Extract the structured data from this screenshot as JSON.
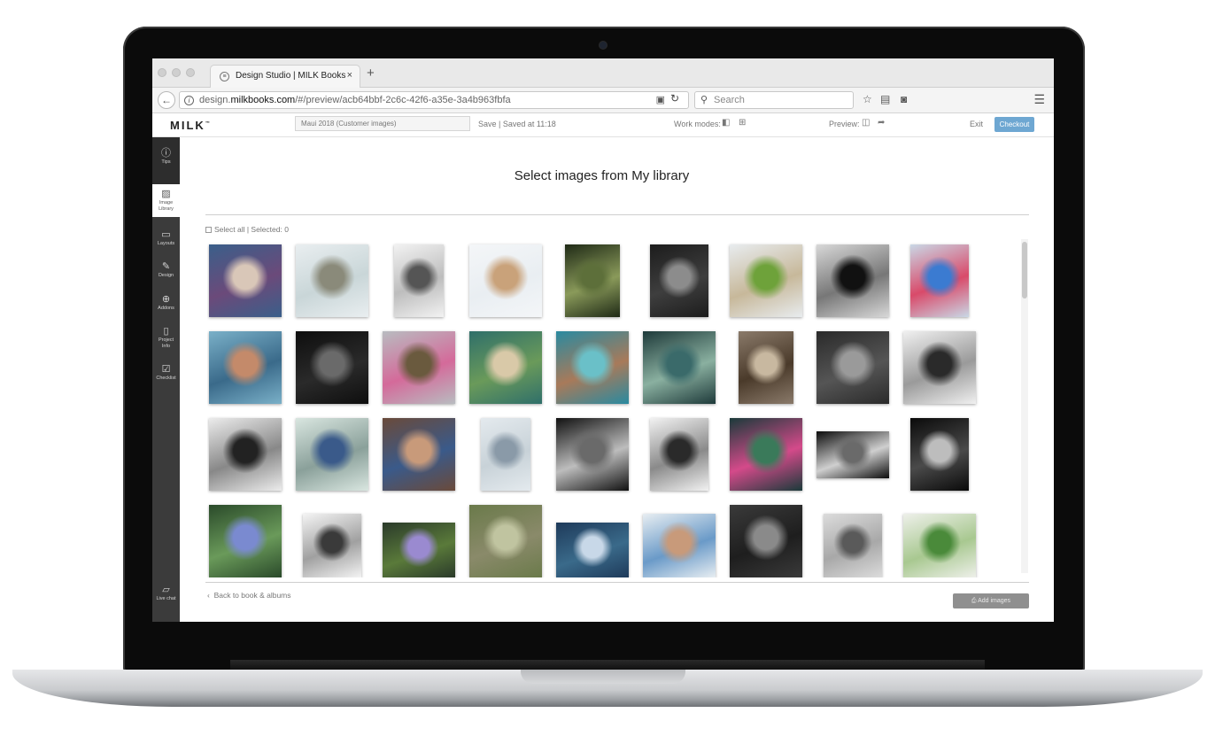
{
  "browser": {
    "tab_title": "Design Studio | MILK Books",
    "tab_close": "×",
    "new_tab": "+",
    "url_prefix": "design.",
    "url_domain": "milkbooks.com",
    "url_path": "/#/preview/acb64bbf-2c6c-42f6-a35e-3a4b963fbfa",
    "search_placeholder": "Search",
    "icons": [
      "back-arrow-icon",
      "info-icon",
      "reader-icon",
      "reload-icon",
      "search-icon",
      "star-icon",
      "clipboard-icon",
      "pocket-icon",
      "menu-icon"
    ]
  },
  "app": {
    "logo": "MILK",
    "logo_mark": "™",
    "project_name": "Maui 2018 (Customer images)",
    "save_status": "Save  |  Saved at 11:18",
    "work_modes_label": "Work modes:",
    "preview_label": "Preview:",
    "exit_label": "Exit",
    "checkout_label": "Checkout"
  },
  "sidebar": {
    "items": [
      {
        "label": "Tips",
        "icon": "info-icon"
      },
      {
        "label": "Image Library",
        "icon": "image-icon"
      },
      {
        "label": "Layouts",
        "icon": "layouts-icon"
      },
      {
        "label": "Design",
        "icon": "pencil-icon"
      },
      {
        "label": "Addons",
        "icon": "addons-icon"
      },
      {
        "label": "Project Info",
        "icon": "document-icon"
      },
      {
        "label": "Checklist",
        "icon": "checklist-icon"
      },
      {
        "label": "Live chat",
        "icon": "chat-icon"
      }
    ]
  },
  "library": {
    "heading": "Select images from My library",
    "select_all": "Select all | Selected: 0",
    "back_link": "Back to book & albums",
    "add_images": "Add images"
  },
  "photos": [
    {
      "subject": "girl-in-blanket",
      "colors": [
        "#3a5f8a",
        "#d9c7b8",
        "#6b4a7a"
      ]
    },
    {
      "subject": "fluffy-dog",
      "colors": [
        "#e9eef0",
        "#8a8a7a",
        "#c9d6d8"
      ]
    },
    {
      "subject": "girl-portrait-bw",
      "colors": [
        "#f2f2f2",
        "#555",
        "#bdbdbd"
      ]
    },
    {
      "subject": "girl-with-hat",
      "colors": [
        "#f4f6f8",
        "#c9a27a",
        "#e9eef2"
      ]
    },
    {
      "subject": "mossy-tree",
      "colors": [
        "#1f2a16",
        "#5d6f3a",
        "#8a9a5a"
      ]
    },
    {
      "subject": "child-at-table-bw",
      "colors": [
        "#1c1c1c",
        "#8c8c8c",
        "#3e3e3e"
      ]
    },
    {
      "subject": "dog-on-lawn",
      "colors": [
        "#e8ecef",
        "#6ea23a",
        "#c7b89a"
      ]
    },
    {
      "subject": "girl-fur-hat-bw",
      "colors": [
        "#d8d8d8",
        "#111",
        "#777"
      ]
    },
    {
      "subject": "girl-in-snow",
      "colors": [
        "#c9d8e6",
        "#3b7bd1",
        "#d94a6a"
      ]
    },
    {
      "subject": "family-hug",
      "colors": [
        "#7ab0c8",
        "#c48a6a",
        "#3a6a8a"
      ]
    },
    {
      "subject": "child-by-window-bw",
      "colors": [
        "#0e0e0e",
        "#6a6a6a",
        "#2a2a2a"
      ]
    },
    {
      "subject": "girl-in-field",
      "colors": [
        "#b8bcc0",
        "#6a5a3e",
        "#d46a9a"
      ]
    },
    {
      "subject": "girls-at-foosball",
      "colors": [
        "#2f6f6a",
        "#d9c9a8",
        "#6a9a5a"
      ]
    },
    {
      "subject": "kid-in-lake",
      "colors": [
        "#2a8aa0",
        "#6ac0c8",
        "#a87a5a"
      ]
    },
    {
      "subject": "girl-in-forest",
      "colors": [
        "#1e3a3a",
        "#3a6a6a",
        "#8ab0a0"
      ]
    },
    {
      "subject": "kid-on-tracks",
      "colors": [
        "#8a7a6a",
        "#c8b8a0",
        "#4a3a2a"
      ]
    },
    {
      "subject": "kids-swimming-bw",
      "colors": [
        "#2a2a2a",
        "#9a9a9a",
        "#555"
      ]
    },
    {
      "subject": "child-blowing-bw",
      "colors": [
        "#f0f0f0",
        "#2a2a2a",
        "#9a9a9a"
      ]
    },
    {
      "subject": "kids-on-pier-bw",
      "colors": [
        "#ececec",
        "#222",
        "#888"
      ]
    },
    {
      "subject": "boy-in-snow",
      "colors": [
        "#d9e6e0",
        "#3a5a8a",
        "#8aa09a"
      ]
    },
    {
      "subject": "girl-holding-hands",
      "colors": [
        "#6a4a3a",
        "#c89a7a",
        "#3a5a8a"
      ]
    },
    {
      "subject": "dock-on-water",
      "colors": [
        "#e4eaee",
        "#8a9aa8",
        "#c8d2d8"
      ]
    },
    {
      "subject": "girl-fur-hat-2-bw",
      "colors": [
        "#111",
        "#6a6a6a",
        "#bdbdbd"
      ]
    },
    {
      "subject": "boy-with-dog-bw",
      "colors": [
        "#f2f2f2",
        "#2a2a2a",
        "#8a8a8a"
      ]
    },
    {
      "subject": "pink-flowers",
      "colors": [
        "#1a3a3a",
        "#3a7a5a",
        "#d44a8a"
      ]
    },
    {
      "subject": "girl-lying-bw",
      "colors": [
        "#0c0c0c",
        "#6a6a6a",
        "#cfcfcf"
      ]
    },
    {
      "subject": "girl-with-dog-bw",
      "colors": [
        "#0a0a0a",
        "#bdbdbd",
        "#4a4a4a"
      ]
    },
    {
      "subject": "thistle-flowers",
      "colors": [
        "#2a4a2a",
        "#7a8ad0",
        "#6a9a5a"
      ]
    },
    {
      "subject": "girl-with-cat-bw",
      "colors": [
        "#f4f4f4",
        "#3a3a3a",
        "#a0a0a0"
      ]
    },
    {
      "subject": "lavender-flowers",
      "colors": [
        "#2a3a2a",
        "#9a8ad0",
        "#5a7a3a"
      ]
    },
    {
      "subject": "mossy-rock",
      "colors": [
        "#6a7a4a",
        "#c0c4a0",
        "#8a8a6a"
      ]
    },
    {
      "subject": "white-petals",
      "colors": [
        "#1e3a5a",
        "#c8d8e8",
        "#3a6a8a"
      ]
    },
    {
      "subject": "two-girls",
      "colors": [
        "#e8eef2",
        "#c89a7a",
        "#6a9ac8"
      ]
    },
    {
      "subject": "wood-planks-bw",
      "colors": [
        "#3a3a3a",
        "#8a8a8a",
        "#1e1e1e"
      ]
    },
    {
      "subject": "mother-daughter-bw",
      "colors": [
        "#dcdcdc",
        "#5a5a5a",
        "#a8a8a8"
      ]
    },
    {
      "subject": "green-leaves",
      "colors": [
        "#eef0ea",
        "#4a8a3a",
        "#a8c890"
      ]
    }
  ]
}
